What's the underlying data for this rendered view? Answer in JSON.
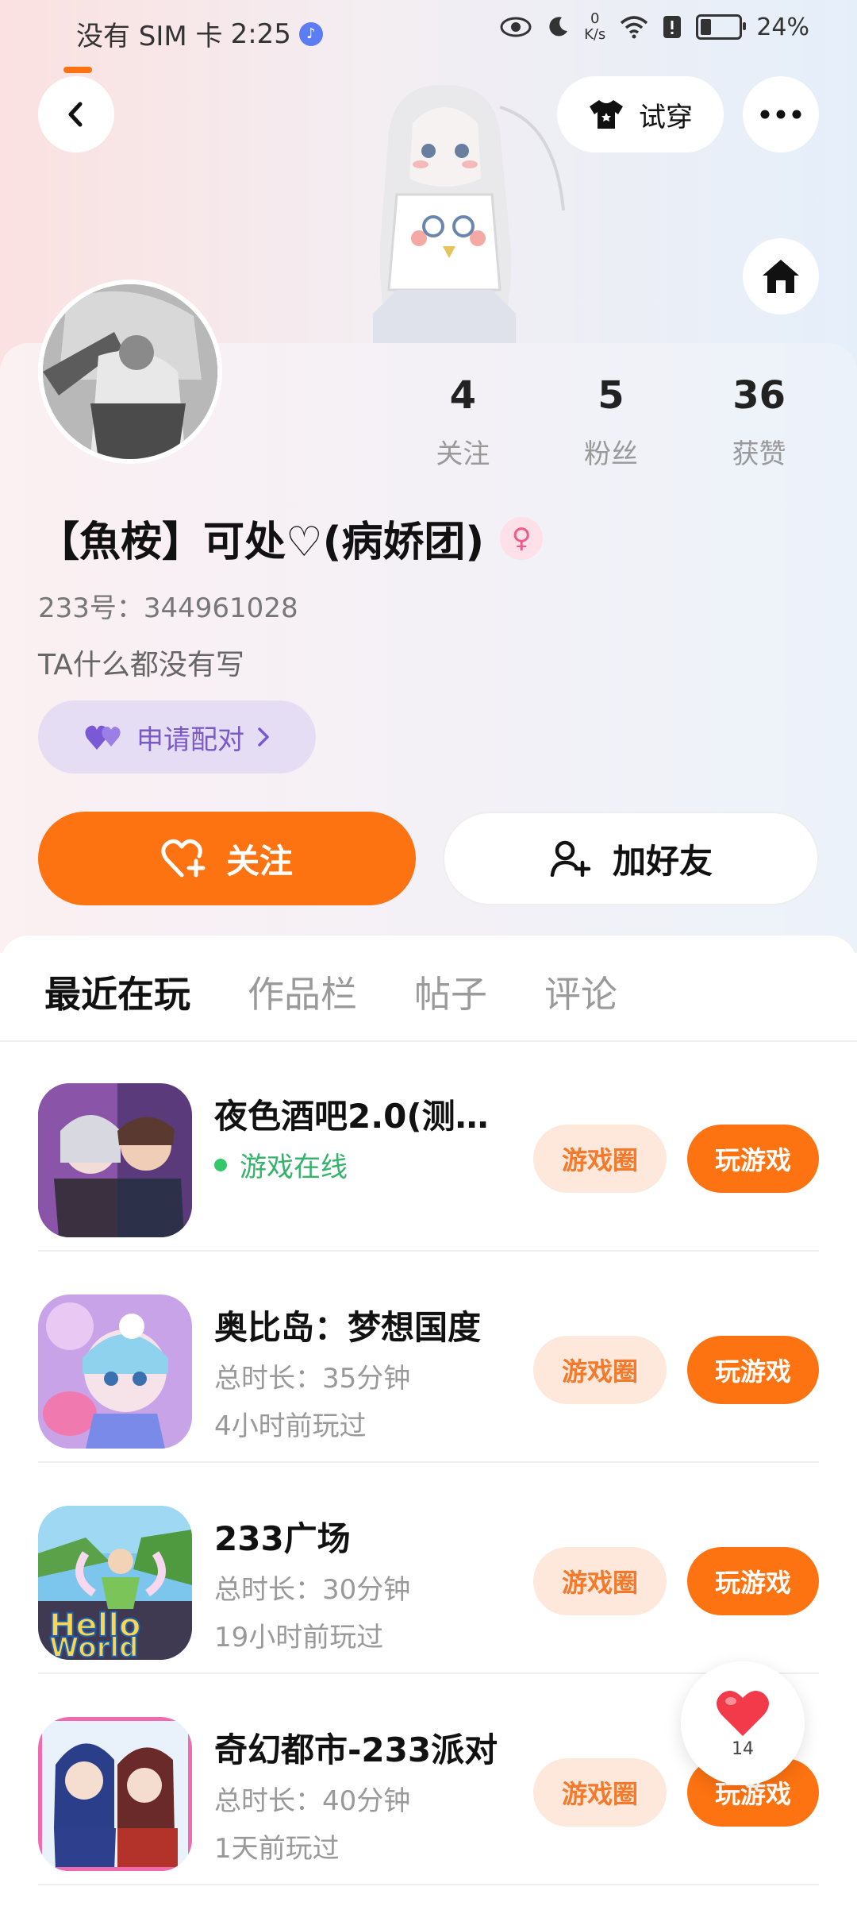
{
  "status_bar": {
    "carrier": "没有 SIM 卡",
    "time": "2:25",
    "net_speed_value": "0",
    "net_speed_unit": "K/s",
    "battery": "24%",
    "battery_level": 0.24
  },
  "header": {
    "try_on_label": "试穿"
  },
  "profile": {
    "following_count": "4",
    "following_label": "关注",
    "fans_count": "5",
    "fans_label": "粉丝",
    "likes_count": "36",
    "likes_label": "获赞",
    "nickname": "【魚桉】可处♡(病娇团)",
    "gender_icon": "♀",
    "uid": "233号：344961028",
    "bio": "TA什么都没有写",
    "pair_label": "申请配对",
    "follow_label": "关注",
    "add_friend_label": "加好友"
  },
  "tabs": [
    {
      "label": "最近在玩"
    },
    {
      "label": "作品栏"
    },
    {
      "label": "帖子"
    },
    {
      "label": "评论"
    }
  ],
  "games": [
    {
      "title": "夜色酒吧2.0(测…",
      "meta1": "游戏在线",
      "meta2": "",
      "circle_label": "游戏圈",
      "play_label": "玩游戏"
    },
    {
      "title": "奥比岛：梦想国度",
      "meta1": "总时长：35分钟",
      "meta2": "4小时前玩过",
      "circle_label": "游戏圈",
      "play_label": "玩游戏"
    },
    {
      "title": "233广场",
      "meta1": "总时长：30分钟",
      "meta2": "19小时前玩过",
      "circle_label": "游戏圈",
      "play_label": "玩游戏"
    },
    {
      "title": "奇幻都市-233派对",
      "meta1": "总时长：40分钟",
      "meta2": "1天前玩过",
      "circle_label": "游戏圈",
      "play_label": "玩游戏"
    }
  ],
  "floating_like": {
    "count": "14"
  },
  "colors": {
    "accent": "#fd7211",
    "accent_light": "#fde8db",
    "pair_bg": "#e5ddf4",
    "online": "#35c86a"
  }
}
